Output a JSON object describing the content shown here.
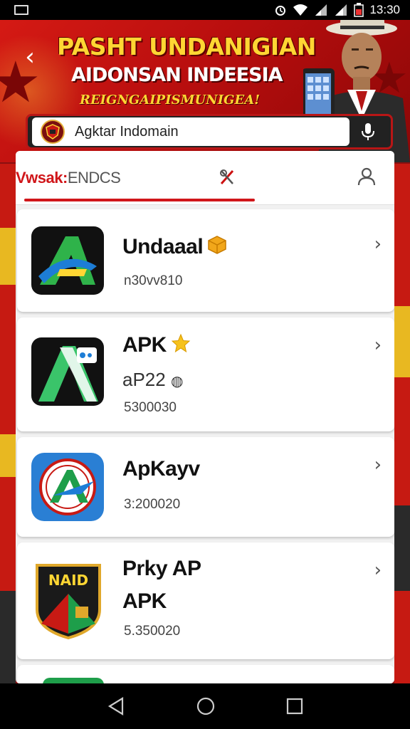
{
  "status_bar": {
    "time": "13:30"
  },
  "hero": {
    "title": "PASHT UNDANIGIAN",
    "subtitle": "AIDONSAN INDEESIA",
    "tagline": "REIGNGAIPISMUNIGEA!"
  },
  "search": {
    "value": "Agktar Indomain"
  },
  "tabs": {
    "main_red": "Vwsak:",
    "main_grey": "ENDCS"
  },
  "apps": [
    {
      "name": "Undaaal",
      "meta": "n30vv810",
      "badge": "cube"
    },
    {
      "name": "APK",
      "sub": "aP22",
      "meta": "5300030",
      "badge": "star"
    },
    {
      "name": "ApKayv",
      "meta": "3:200020"
    },
    {
      "name": "Prky AP",
      "sub": "APK",
      "meta": "5.350020"
    }
  ],
  "icons": [
    "back-arrow",
    "mic-icon",
    "user-icon",
    "chevron-right-icon",
    "nav-back",
    "nav-home",
    "nav-recents"
  ],
  "colors": {
    "accent": "#d0161a",
    "banner": "#c4120f",
    "gold": "#ffd633"
  }
}
